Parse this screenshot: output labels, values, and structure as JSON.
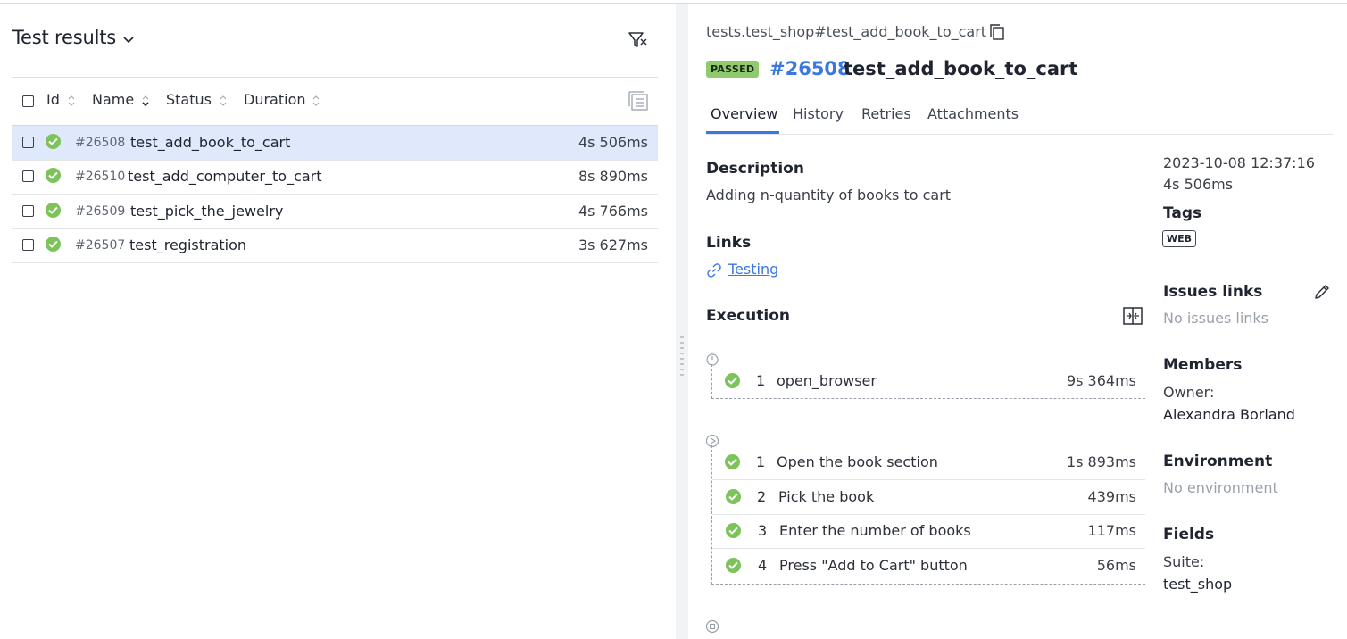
{
  "left": {
    "title": "Test results",
    "columns": {
      "id": "Id",
      "name": "Name",
      "status": "Status",
      "duration": "Duration"
    },
    "rows": [
      {
        "id": "#26508",
        "name": "test_add_book_to_cart",
        "duration": "4s 506ms",
        "status": "passed",
        "selected": true
      },
      {
        "id": "#26510",
        "name": "test_add_computer_to_cart",
        "duration": "8s 890ms",
        "status": "passed",
        "selected": false
      },
      {
        "id": "#26509",
        "name": "test_pick_the_jewelry",
        "duration": "4s 766ms",
        "status": "passed",
        "selected": false
      },
      {
        "id": "#26507",
        "name": "test_registration",
        "duration": "3s 627ms",
        "status": "passed",
        "selected": false
      }
    ]
  },
  "detail": {
    "breadcrumb": "tests.test_shop#test_add_book_to_cart",
    "status_badge": "PASSED",
    "test_id": "#26508",
    "test_name": "test_add_book_to_cart",
    "tabs": [
      "Overview",
      "History",
      "Retries",
      "Attachments"
    ],
    "active_tab": "Overview",
    "description_title": "Description",
    "description": "Adding n-quantity of books to cart",
    "links_title": "Links",
    "link_text": "Testing",
    "execution_title": "Execution",
    "setup_steps": [
      {
        "num": "1",
        "name": "open_browser",
        "duration": "9s 364ms"
      }
    ],
    "body_steps": [
      {
        "num": "1",
        "name": "Open the book section",
        "duration": "1s 893ms"
      },
      {
        "num": "2",
        "name": "Pick the book",
        "duration": "439ms"
      },
      {
        "num": "3",
        "name": "Enter the number of books",
        "duration": "117ms"
      },
      {
        "num": "4",
        "name": "Press \"Add to Cart\" button",
        "duration": "56ms"
      }
    ]
  },
  "side": {
    "datetime": "2023-10-08 12:37:16",
    "duration": "4s 506ms",
    "tags_title": "Tags",
    "tag": "WEB",
    "issues_title": "Issues links",
    "issues_empty": "No issues links",
    "members_title": "Members",
    "owner_label": "Owner:",
    "owner_name": "Alexandra Borland",
    "env_title": "Environment",
    "env_empty": "No environment",
    "fields_title": "Fields",
    "suite_label": "Suite:",
    "suite_value": "test_shop"
  },
  "colors": {
    "accent": "#3a78e0",
    "passed": "#7cc35a",
    "selected_row": "#dfe9fb"
  }
}
